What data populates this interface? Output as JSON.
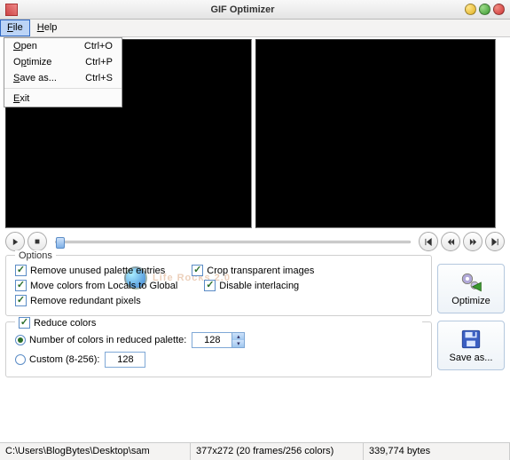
{
  "window": {
    "title": "GIF Optimizer"
  },
  "menubar": {
    "file": "File",
    "help": "Help"
  },
  "file_menu": {
    "open": {
      "label": "Open",
      "shortcut": "Ctrl+O"
    },
    "optimize": {
      "label": "Optimize",
      "shortcut": "Ctrl+P"
    },
    "saveas": {
      "label": "Save as...",
      "shortcut": "Ctrl+S"
    },
    "exit": {
      "label": "Exit"
    }
  },
  "options": {
    "legend": "Options",
    "remove_unused": "Remove unused palette entries",
    "crop_transparent": "Crop transparent images",
    "move_colors": "Move colors from Locals to Global",
    "disable_interlace": "Disable interlacing",
    "remove_redundant": "Remove redundant pixels"
  },
  "reduce": {
    "legend": "Reduce colors",
    "num_colors_label": "Number of colors in reduced palette:",
    "num_colors_value": "128",
    "custom_label": "Custom (8-256):",
    "custom_value": "128"
  },
  "buttons": {
    "optimize": "Optimize",
    "saveas": "Save as..."
  },
  "status": {
    "path": "C:\\Users\\BlogBytes\\Desktop\\sam",
    "dims": "377x272 (20 frames/256 colors)",
    "size": "339,774 bytes"
  },
  "watermark": "Life Rocks 2.0",
  "icons": {
    "play": "play-icon",
    "stop": "stop-icon",
    "first": "first-icon",
    "prev": "prev-icon",
    "next": "next-icon",
    "last": "last-icon"
  }
}
